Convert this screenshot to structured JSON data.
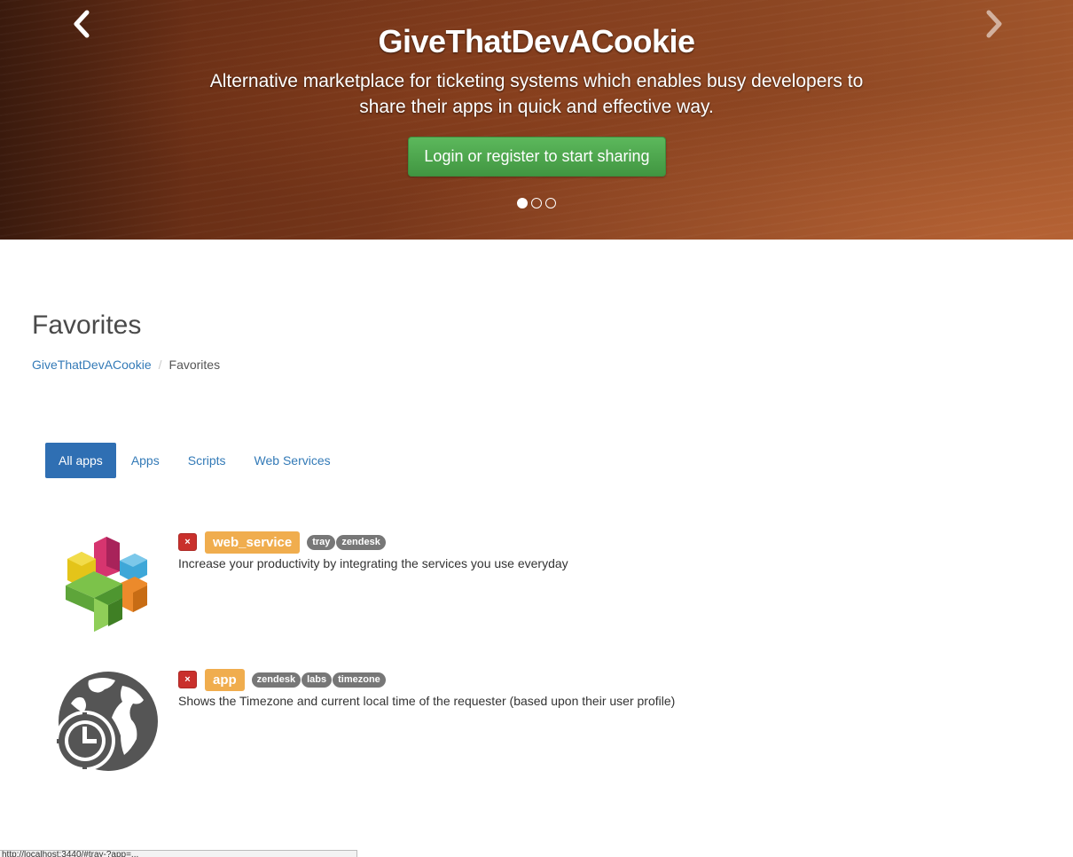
{
  "hero": {
    "title": "GiveThatDevACookie",
    "subtitle": "Alternative marketplace for ticketing systems which enables busy developers to share their apps in quick and effective way.",
    "cta_label": "Login or register to start sharing",
    "prev_icon": "chevron-left-icon",
    "next_icon": "chevron-right-icon",
    "slide_count": 3,
    "active_slide": 1
  },
  "page": {
    "title": "Favorites",
    "breadcrumb": [
      "GiveThatDevACookie",
      "Favorites"
    ]
  },
  "tabs": [
    {
      "label": "All apps",
      "active": true
    },
    {
      "label": "Apps",
      "active": false
    },
    {
      "label": "Scripts",
      "active": false
    },
    {
      "label": "Web Services",
      "active": false
    }
  ],
  "apps": [
    {
      "logo": "tray-logo-icon",
      "remove_symbol": "×",
      "type": "web_service",
      "tags": [
        "tray",
        "zendesk"
      ],
      "description": "Increase your productivity by integrating the services you use everyday"
    },
    {
      "logo": "globe-clock-icon",
      "remove_symbol": "×",
      "type": "app",
      "tags": [
        "zendesk",
        "labs",
        "timezone"
      ],
      "description": "Shows the Timezone and current local time of the requester (based upon their user profile)"
    }
  ],
  "status_bar": {
    "text": "http://localhost:3440/#tray-?app=..."
  },
  "colors": {
    "primary": "#2f6fb3",
    "success": "#5cb85c",
    "warning": "#f0ad4e",
    "danger": "#c9302c",
    "tag": "#777777"
  }
}
